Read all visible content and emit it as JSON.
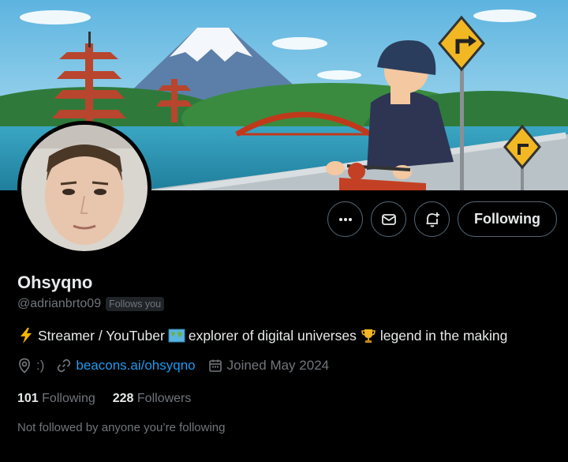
{
  "profile": {
    "name": "Ohsyqno",
    "handle": "@adrianbrto09",
    "follows_you": "Follows you",
    "bio": {
      "part1": "Streamer / YouTuber",
      "part2": "explorer of digital universes",
      "part3": "legend in the making"
    },
    "location": ":)",
    "link": "beacons.ai/ohsyqno",
    "joined": "Joined May 2024",
    "following_count": "101",
    "following_label": "Following",
    "followers_count": "228",
    "followers_label": "Followers",
    "not_followed": "Not followed by anyone you’re following"
  },
  "actions": {
    "follow_button": "Following"
  },
  "icons": {
    "more": "more-icon",
    "message": "envelope-icon",
    "notify": "bell-plus-icon",
    "location": "location-pin-icon",
    "link": "link-icon",
    "calendar": "calendar-icon"
  },
  "colors": {
    "accent": "#1d9bf0",
    "muted": "#71767b",
    "text": "#e7e9ea",
    "border": "#536471"
  }
}
